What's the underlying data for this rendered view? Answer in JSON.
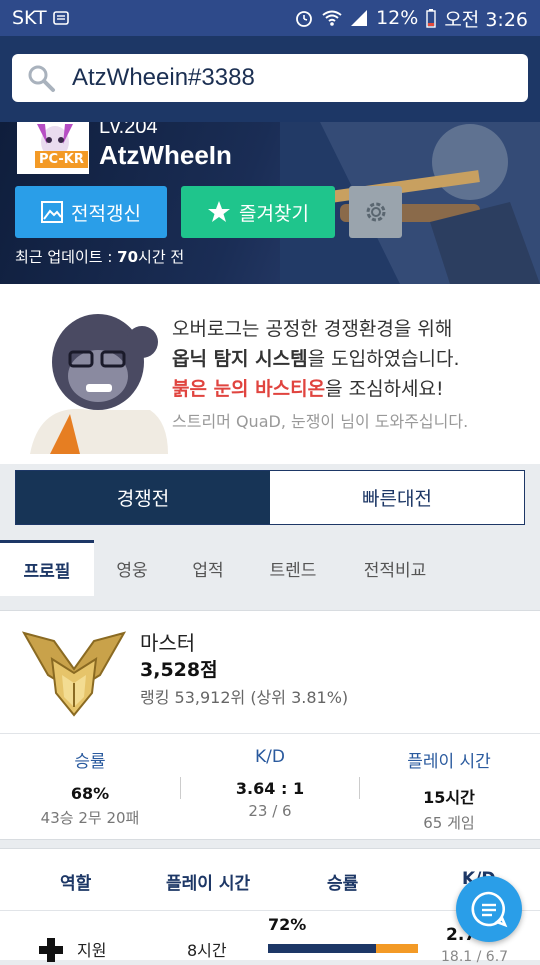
{
  "statusbar": {
    "carrier": "SKT",
    "battery": "12%",
    "time": "오전 3:26"
  },
  "search": {
    "value": "AtzWheein#3388"
  },
  "profile": {
    "level": "Lv.204",
    "platform": "PC-KR",
    "name": "AtzWheeIn",
    "refresh_label": "전적갱신",
    "favorite_label": "즐겨찾기",
    "updated_prefix": "최근 업데이트 : ",
    "updated_value": "70",
    "updated_suffix": "시간 전"
  },
  "notice": {
    "line1": "오버로그는 공정한 경쟁환경을 위해",
    "line2_bold": "옵닉 탐지 시스템",
    "line2_rest": "을 도입하였습니다.",
    "line3_red": "붉은 눈의 바스티온",
    "line3_rest": "을 조심하세요!",
    "line4": "스트리머 QuaD, 눈쟁이 님이 도와주십니다."
  },
  "mode_tabs": [
    "경쟁전",
    "빠른대전"
  ],
  "sub_tabs": [
    "프로필",
    "영웅",
    "업적",
    "트렌드",
    "전적비교"
  ],
  "rank": {
    "tier": "마스터",
    "score": "3,528점",
    "ranking": "랭킹 53,912위 (상위 3.81%)"
  },
  "stats": [
    {
      "label": "승률",
      "value": "68%",
      "sub": "43승 2무 20패"
    },
    {
      "label": "K/D",
      "value": "3.64 : 1",
      "sub": "23 / 6"
    },
    {
      "label": "플레이 시간",
      "value": "15시간",
      "sub": "65 게임"
    }
  ],
  "roles": {
    "headers": [
      "역할",
      "플레이 시간",
      "승률",
      "K/D"
    ],
    "rows": [
      {
        "role": "지원",
        "time": "8시간",
        "winrate": "72%",
        "winrate_fraction": 0.72,
        "kd": "2.7",
        "kd_sub": "18.1 / 6.7"
      }
    ]
  },
  "colors": {
    "header_bg": "#1d3766",
    "statusbar_bg": "#2e4a8a",
    "refresh_btn": "#2a9ee8",
    "favorite_btn": "#1fc58c",
    "loss_bar": "#f39a26",
    "win_bar": "#1d3766",
    "alert_red": "#e0443f"
  }
}
